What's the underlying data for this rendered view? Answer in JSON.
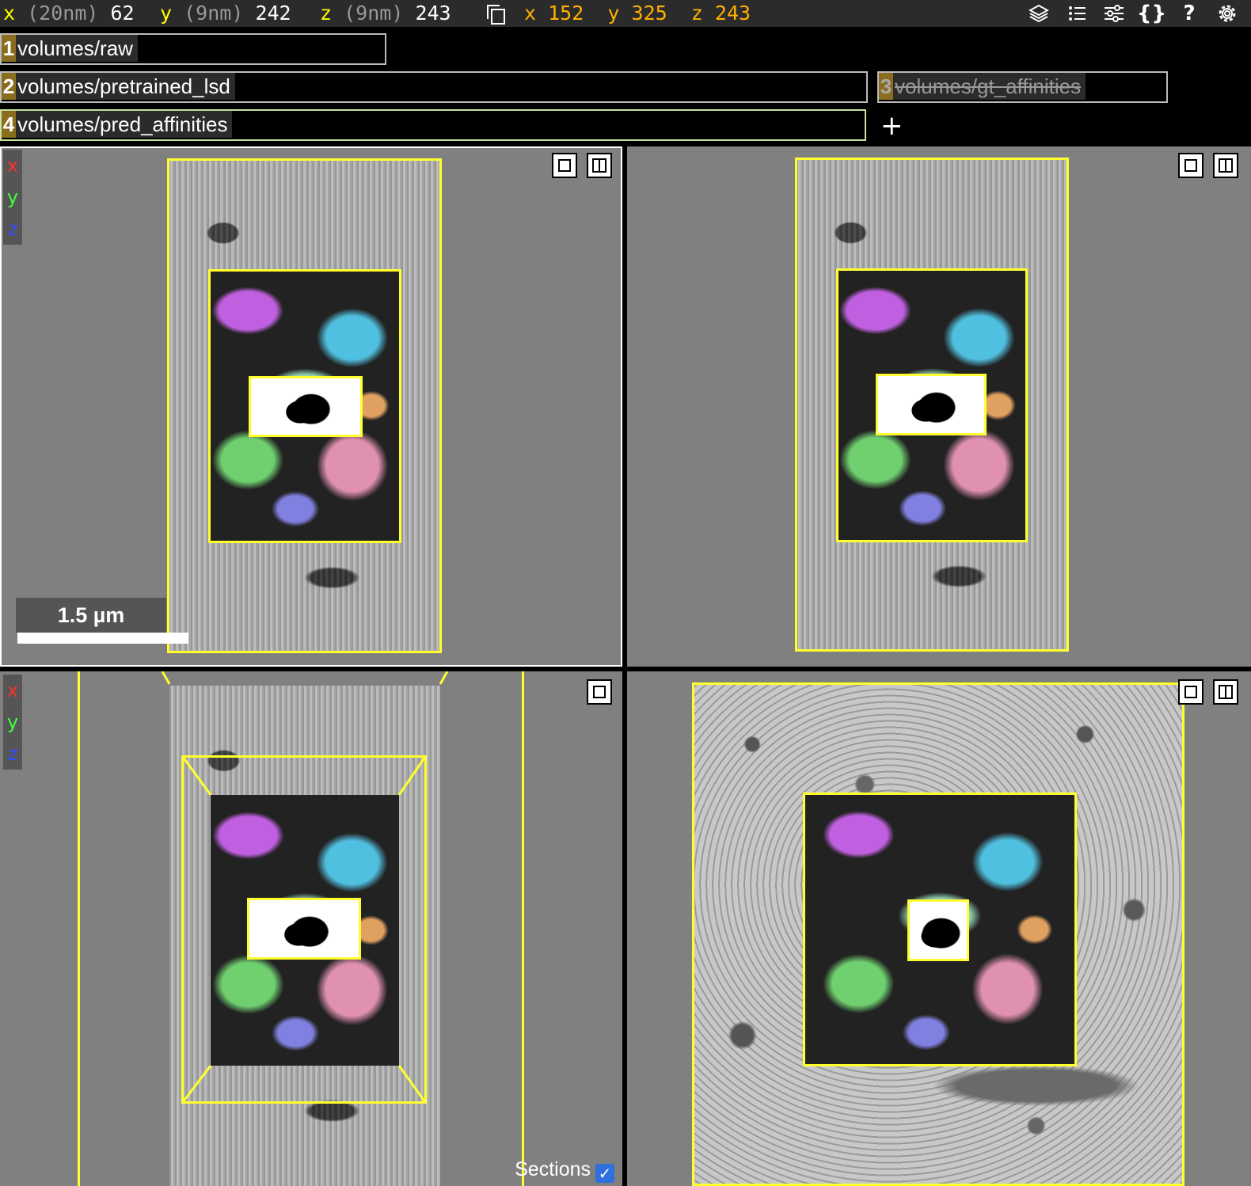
{
  "position_bar": {
    "x": {
      "label": "x",
      "unit": "(20nm)",
      "value": "62"
    },
    "y": {
      "label": "y",
      "unit": "(9nm)",
      "value": "242"
    },
    "z": {
      "label": "z",
      "unit": "(9nm)",
      "value": "243"
    },
    "mouse": {
      "x_label": "x",
      "x": "152",
      "y_label": "y",
      "y": "325",
      "z_label": "z",
      "z": "243"
    }
  },
  "toolbar": {
    "layers_icon": "layers-icon",
    "list_icon": "list-icon",
    "sliders_icon": "sliders-icon",
    "json_label": "{}",
    "help_label": "?",
    "settings_icon": "gear-icon"
  },
  "layers": [
    {
      "number": "1",
      "name": "volumes/raw",
      "visible": true
    },
    {
      "number": "2",
      "name": "volumes/pretrained_lsd",
      "visible": true
    },
    {
      "number": "3",
      "name": "volumes/gt_affinities",
      "visible": false
    },
    {
      "number": "4",
      "name": "volumes/pred_affinities",
      "visible": true
    }
  ],
  "add_layer_label": "+",
  "axes": {
    "x": "x",
    "y": "y",
    "z": "z"
  },
  "scale_bar": {
    "label": "1.5 µm"
  },
  "sections": {
    "label": "Sections",
    "checked": true,
    "check_glyph": "✓"
  },
  "colors": {
    "bounding_box": "#ffff30",
    "layer_number_bg": "#8a6d1e",
    "position_label": "#ffff00",
    "mouse_position": "#ffb000"
  }
}
